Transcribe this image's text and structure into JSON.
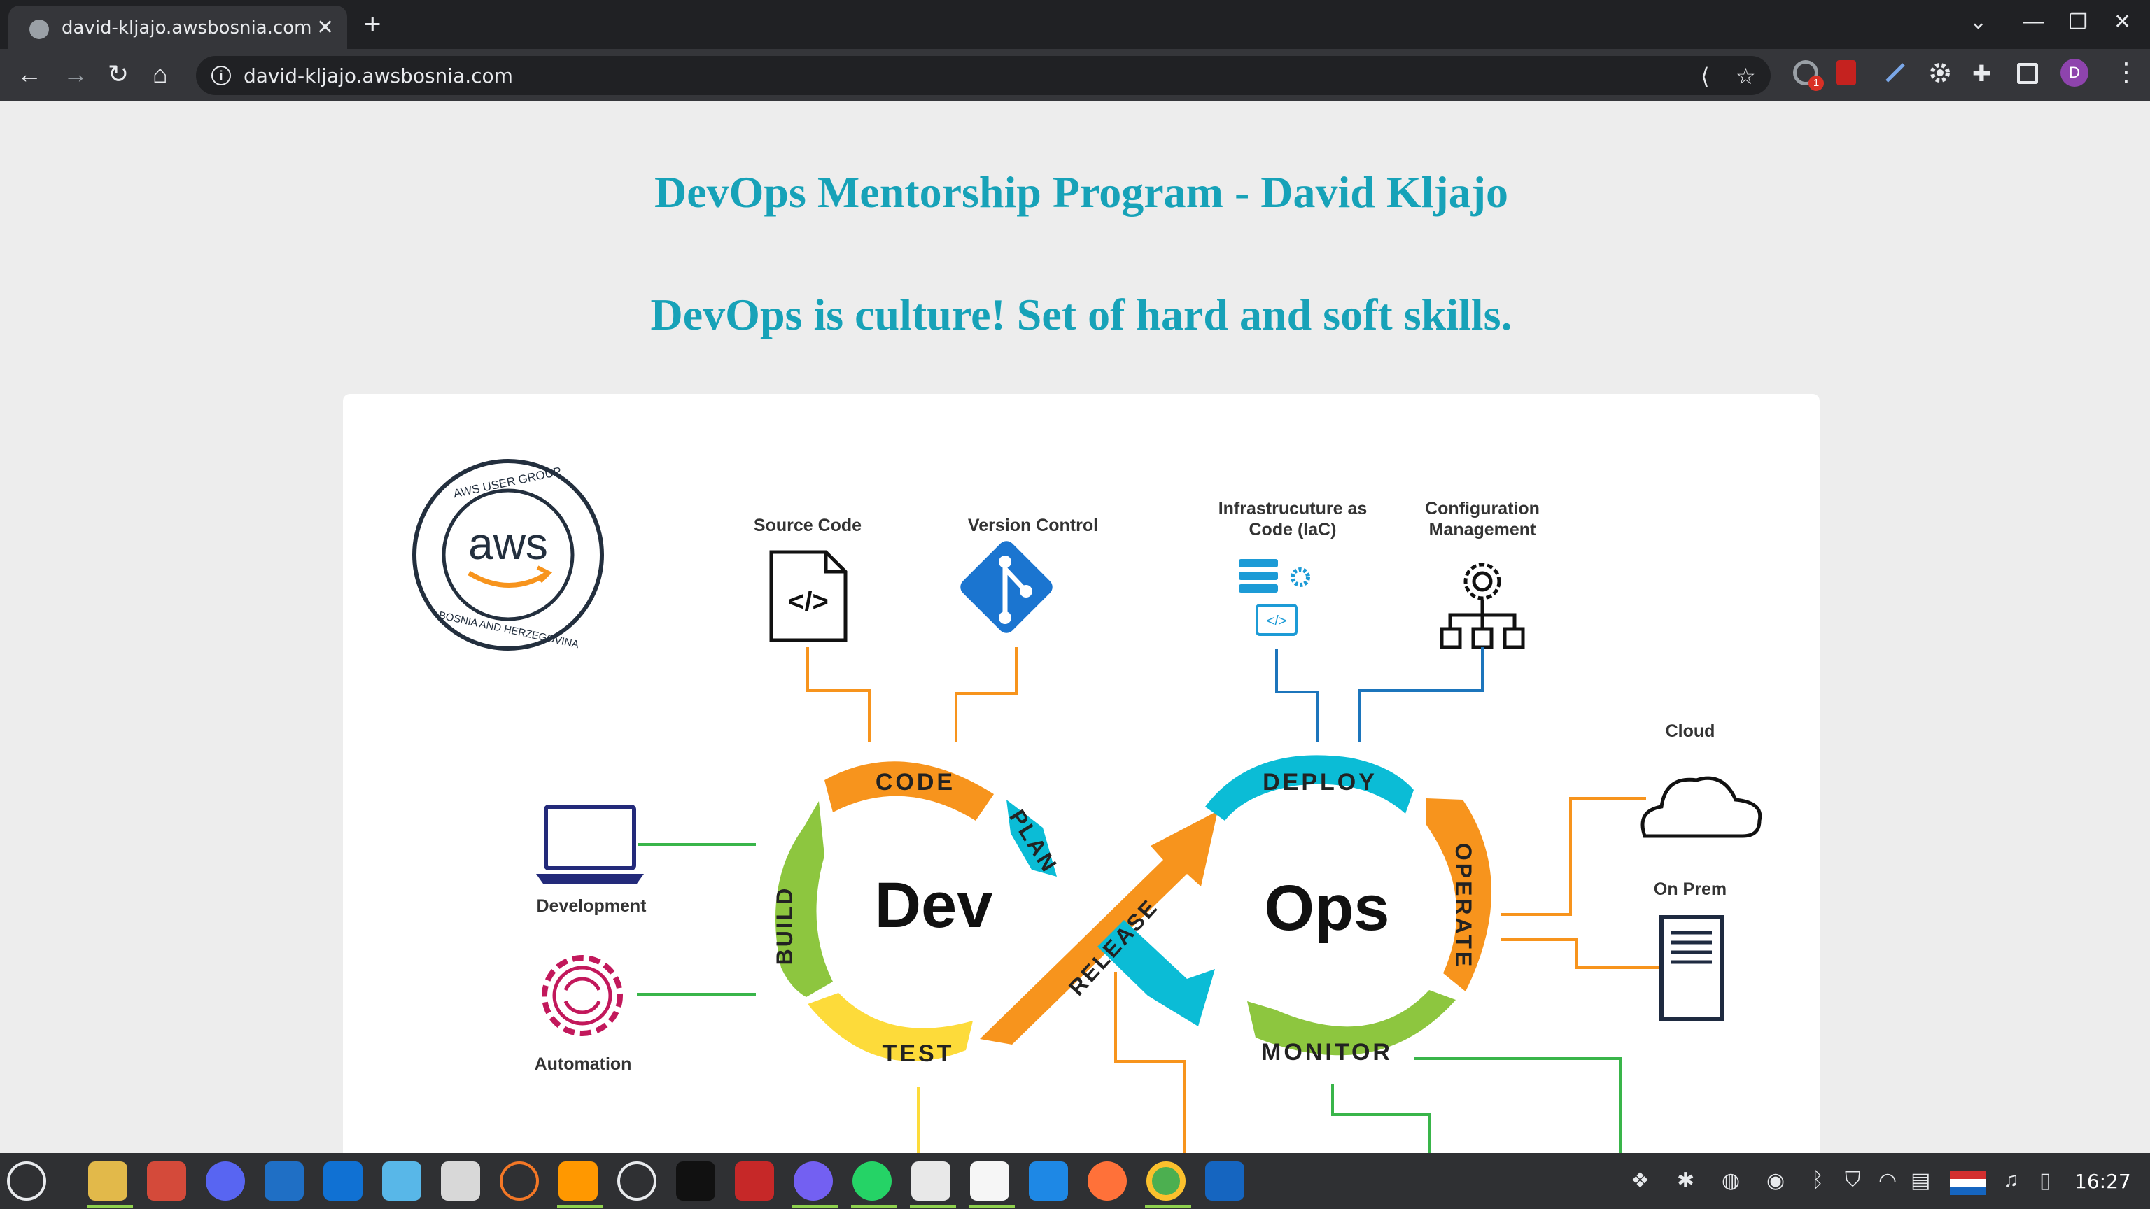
{
  "browser": {
    "tab_title": "david-kljajo.awsbosnia.com",
    "tab_close": "✕",
    "new_tab": "+",
    "url": "david-kljajo.awsbosnia.com",
    "win_controls": {
      "dropdown": "⌄",
      "minimize": "—",
      "restore": "❐",
      "close": "✕"
    },
    "profile_initial": "D",
    "extension_badge": "1"
  },
  "page": {
    "title": "DevOps Mentorship Program - David Kljajo",
    "subtitle": "DevOps is culture! Set of hard and soft skills."
  },
  "diagram": {
    "logo": {
      "top_text": "AWS USER GROUP",
      "center_text": "aws",
      "bottom_text": "BOSNIA AND HERZEGOVINA"
    },
    "tools": {
      "source_code": "Source Code",
      "version_control": "Version Control",
      "iac_line1": "Infrastrucuture as",
      "iac_line2": "Code (IaC)",
      "config_line1": "Configuration",
      "config_line2": "Management",
      "cloud": "Cloud",
      "on_prem": "On Prem",
      "development": "Development",
      "automation": "Automation"
    },
    "loop": {
      "dev": "Dev",
      "ops": "Ops",
      "code": "CODE",
      "plan": "PLAN",
      "build": "BUILD",
      "test": "TEST",
      "release": "RELEASE",
      "deploy": "DEPLOY",
      "operate": "OPERATE",
      "monitor": "MONITOR"
    },
    "colors": {
      "orange": "#f7941d",
      "cyan": "#0bbcd6",
      "green": "#8dc63f",
      "yellow": "#fddb3a",
      "line_orange": "#f7941d",
      "line_blue": "#1c75bc",
      "line_green": "#39b54a"
    }
  },
  "taskbar": {
    "clock": "16:27",
    "apps": [
      "mint-menu-icon",
      "files-icon",
      "gimp-icon",
      "discord-icon",
      "wireshark-icon",
      "joplin-icon",
      "edge-icon",
      "text-editor-icon",
      "jupyter-icon",
      "sublime-icon",
      "spider-icon",
      "terminal-icon",
      "red-terminal-icon",
      "viber-icon",
      "whatsapp-icon",
      "slack-icon",
      "drawing-icon",
      "vscode-icon",
      "firefox-icon",
      "chrome-icon",
      "notes-icon"
    ]
  }
}
